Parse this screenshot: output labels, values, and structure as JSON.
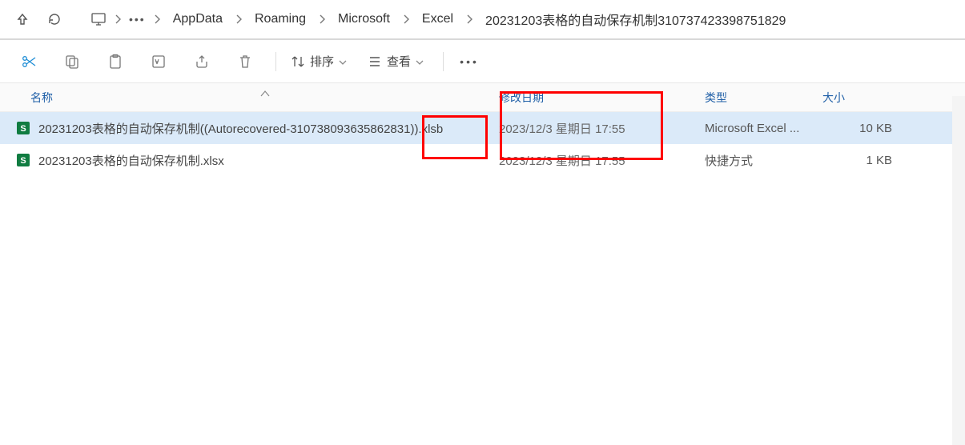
{
  "breadcrumb": {
    "items": [
      "AppData",
      "Roaming",
      "Microsoft",
      "Excel",
      "20231203表格的自动保存机制310737423398751829"
    ]
  },
  "toolbar": {
    "sort_label": "排序",
    "view_label": "查看"
  },
  "columns": {
    "name": "名称",
    "date": "修改日期",
    "type": "类型",
    "size": "大小"
  },
  "rows": [
    {
      "name": "20231203表格的自动保存机制((Autorecovered-310738093635862831)).xlsb",
      "date": "2023/12/3 星期日 17:55",
      "type": "Microsoft Excel ...",
      "size": "10 KB",
      "selected": true,
      "icon": "excel"
    },
    {
      "name": "20231203表格的自动保存机制.xlsx",
      "date": "2023/12/3 星期日 17:55",
      "type": "快捷方式",
      "size": "1 KB",
      "selected": false,
      "icon": "excel"
    }
  ]
}
